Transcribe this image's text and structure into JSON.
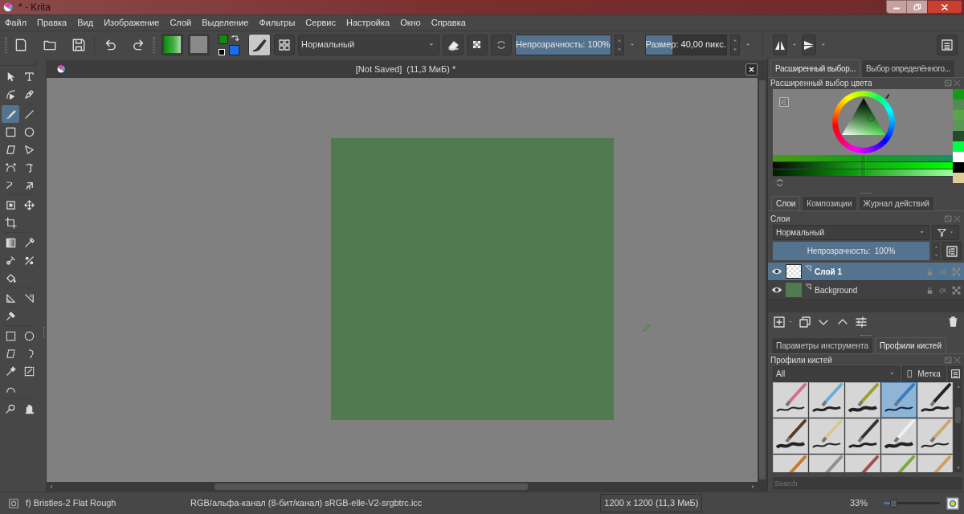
{
  "window": {
    "title": "* - Krita"
  },
  "menu": [
    "Файл",
    "Правка",
    "Вид",
    "Изображение",
    "Слой",
    "Выделение",
    "Фильтры",
    "Сервис",
    "Настройка",
    "Окно",
    "Справка"
  ],
  "toolbar": {
    "blend_mode": "Нормальный",
    "opacity": {
      "label": "Непрозрачность: 100%",
      "level": 1
    },
    "size": {
      "label": "Размер: 40,00 пикс.",
      "level": 0.33
    }
  },
  "toolbox": {
    "groups": [
      [
        {
          "kind": "pointer",
          "selected": false
        },
        {
          "kind": "text",
          "selected": false
        },
        {
          "kind": "shape-edit",
          "selected": false
        },
        {
          "kind": "calligraphy",
          "selected": false
        }
      ],
      [
        {
          "kind": "brush",
          "selected": true
        },
        {
          "kind": "line",
          "selected": false
        },
        {
          "kind": "rectangle",
          "selected": false
        },
        {
          "kind": "ellipse",
          "selected": false
        },
        {
          "kind": "polygon",
          "selected": false
        },
        {
          "kind": "polyline",
          "selected": false
        },
        {
          "kind": "bezier",
          "selected": false
        },
        {
          "kind": "path",
          "selected": false
        },
        {
          "kind": "dynamic",
          "selected": false
        },
        {
          "kind": "multibrush",
          "selected": false
        }
      ],
      [
        {
          "kind": "transform",
          "selected": false
        },
        {
          "kind": "move",
          "selected": false
        },
        {
          "kind": "crop",
          "selected": false
        }
      ],
      [
        {
          "kind": "gradient",
          "selected": false
        },
        {
          "kind": "picker",
          "selected": false
        },
        {
          "kind": "colorize",
          "selected": false
        },
        {
          "kind": "patch",
          "selected": false
        },
        {
          "kind": "fill",
          "selected": false
        }
      ],
      [
        {
          "kind": "assistant",
          "selected": false
        },
        {
          "kind": "measure",
          "selected": false
        },
        {
          "kind": "pin",
          "selected": false
        }
      ],
      [
        {
          "kind": "rect-select",
          "selected": false
        },
        {
          "kind": "ellipse-select",
          "selected": false
        },
        {
          "kind": "poly-select",
          "selected": false
        },
        {
          "kind": "free-select",
          "selected": false
        },
        {
          "kind": "wand",
          "selected": false
        },
        {
          "kind": "similar-select",
          "selected": false
        },
        {
          "kind": "bezier-select",
          "selected": false
        }
      ],
      [
        {
          "kind": "zoom",
          "selected": false
        },
        {
          "kind": "pan",
          "selected": false
        }
      ]
    ]
  },
  "document": {
    "title": "[Not Saved]  (11,3 МиБ) *"
  },
  "right_dock": {
    "top_tabs": [
      {
        "label": "Расширенный выбор...",
        "selected": true
      },
      {
        "label": "Выбор определённого...",
        "selected": false
      }
    ],
    "color_selector": {
      "title": "Расширенный выбор цвета",
      "sliders": [
        {
          "level": 0.48
        },
        {
          "level": 0.48
        },
        {
          "level": 0.48
        }
      ],
      "history": [
        {
          "color": "#169a16"
        },
        {
          "color": "#548a54"
        },
        {
          "color": "#5aa54a"
        },
        {
          "color": "#5a955a"
        },
        {
          "color": "#254a2a"
        },
        {
          "color": "#00ff40"
        },
        {
          "color": "#ffffff"
        },
        {
          "color": "#000000"
        },
        {
          "color": "#e0cc99"
        }
      ]
    },
    "layer_tabs": [
      {
        "label": "Слои",
        "selected": true
      },
      {
        "label": "Композиции",
        "selected": false
      },
      {
        "label": "Журнал действий",
        "selected": false
      }
    ],
    "layers_panel": {
      "title": "Слои",
      "blend_mode": "Нормальный",
      "opacity": {
        "label": "Непрозрачность:  100%",
        "level": 1
      },
      "layers": [
        {
          "name": "Слой 1",
          "selected": true,
          "visible": true,
          "kind": "transparent"
        },
        {
          "name": "Background",
          "selected": false,
          "visible": true,
          "kind": "fill",
          "color": "#517a51"
        }
      ]
    },
    "preset_tabs": [
      {
        "label": "Параметры инструмента",
        "selected": false
      },
      {
        "label": "Профили кистей",
        "selected": true
      }
    ],
    "presets_panel": {
      "title": "Профили кистей",
      "tag_filter": "All",
      "tag_button": "Метка",
      "search": {
        "placeholder": "Search"
      },
      "presets": [
        {
          "color": "#d86a8a",
          "selected": false
        },
        {
          "color": "#6aaed8",
          "selected": false
        },
        {
          "color": "#9aa030",
          "selected": false
        },
        {
          "color": "#3a7ac0",
          "selected": true
        },
        {
          "color": "#222222",
          "selected": false
        },
        {
          "color": "#5a3a2a",
          "selected": false
        },
        {
          "color": "#d8c890",
          "selected": false
        },
        {
          "color": "#333333",
          "selected": false
        },
        {
          "color": "#f0f0f0",
          "selected": false
        },
        {
          "color": "#c8a870",
          "selected": false
        },
        {
          "color": "#c87a2a",
          "selected": false
        },
        {
          "color": "#909090",
          "selected": false
        },
        {
          "color": "#a05050",
          "selected": false
        },
        {
          "color": "#7aaa3a",
          "selected": false
        },
        {
          "color": "#d0a060",
          "selected": false
        }
      ]
    }
  },
  "status_bar": {
    "preset": "f) Bristles-2 Flat Rough",
    "color_space": "RGB/альфа-канал (8-бит/канал) sRGB-elle-V2-srgbtrc.icc",
    "image_size": "1200 x 1200 (11,3 МиБ)",
    "zoom": "33%",
    "zoom_slider": {
      "level": 0.17
    }
  }
}
